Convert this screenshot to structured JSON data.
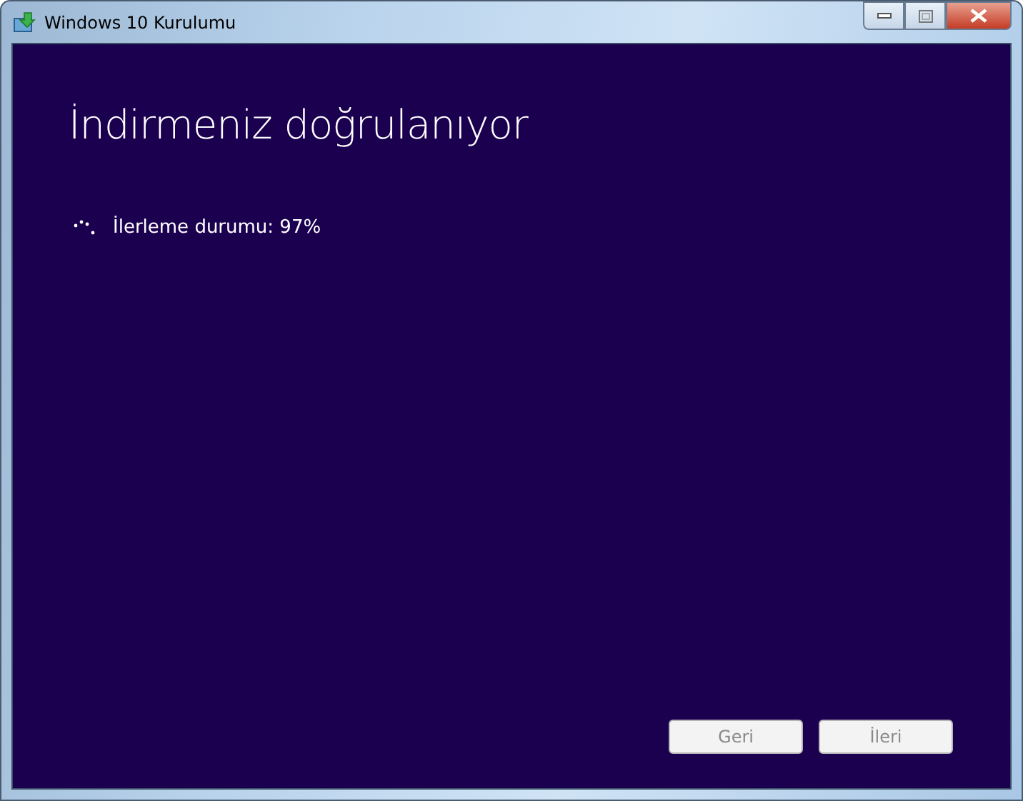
{
  "window": {
    "title": "Windows 10 Kurulumu"
  },
  "heading": "İndirmeniz doğrulanıyor",
  "progress": {
    "label": "İlerleme durumu: 97%"
  },
  "buttons": [
    {
      "label": "Geri",
      "disabled": true
    },
    {
      "label": "İleri",
      "disabled": true
    }
  ]
}
